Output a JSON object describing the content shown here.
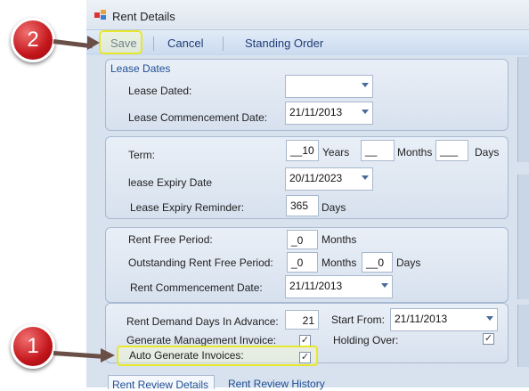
{
  "window": {
    "title": "Rent Details"
  },
  "toolbar": {
    "save": "Save",
    "cancel": "Cancel",
    "standing_order": "Standing Order"
  },
  "lease_dates": {
    "title": "Lease Dates",
    "lease_dated_label": "Lease Dated:",
    "lease_dated_value": "",
    "commencement_label": "Lease Commencement Date:",
    "commencement_value": "21/11/2013"
  },
  "term": {
    "term_label": "Term:",
    "years_value": "__10",
    "years_label": "Years",
    "months_value": "__",
    "months_label": "Months",
    "days_value": "___",
    "days_label": "Days",
    "expiry_label": "lease Expiry Date",
    "expiry_value": "20/11/2023",
    "reminder_label": "Lease  Expiry Reminder:",
    "reminder_value": "365",
    "reminder_unit": "Days"
  },
  "rent_free": {
    "period_label": "Rent Free Period:",
    "period_value": "_0",
    "period_unit": "Months",
    "outstanding_label": "Outstanding Rent Free Period:",
    "outstanding_months_value": "_0",
    "outstanding_months_unit": "Months",
    "outstanding_days_value": "__0",
    "outstanding_days_unit": "Days",
    "rent_commencement_label": "Rent Commencement Date:",
    "rent_commencement_value": "21/11/2013"
  },
  "invoicing": {
    "demand_days_label": "Rent Demand Days In Advance:",
    "demand_days_value": "21",
    "start_from_label": "Start From:",
    "start_from_value": "21/11/2013",
    "mgmt_invoice_label": "Generate Management Invoice:",
    "mgmt_invoice_checked": true,
    "holding_over_label": "Holding Over:",
    "holding_over_checked": true,
    "auto_generate_label": "Auto Generate Invoices:",
    "auto_generate_checked": true,
    "check_glyph": "✓"
  },
  "tabs": [
    "Rent Review Details",
    "Rent Review History"
  ],
  "callouts": {
    "one": "1",
    "two": "2"
  }
}
